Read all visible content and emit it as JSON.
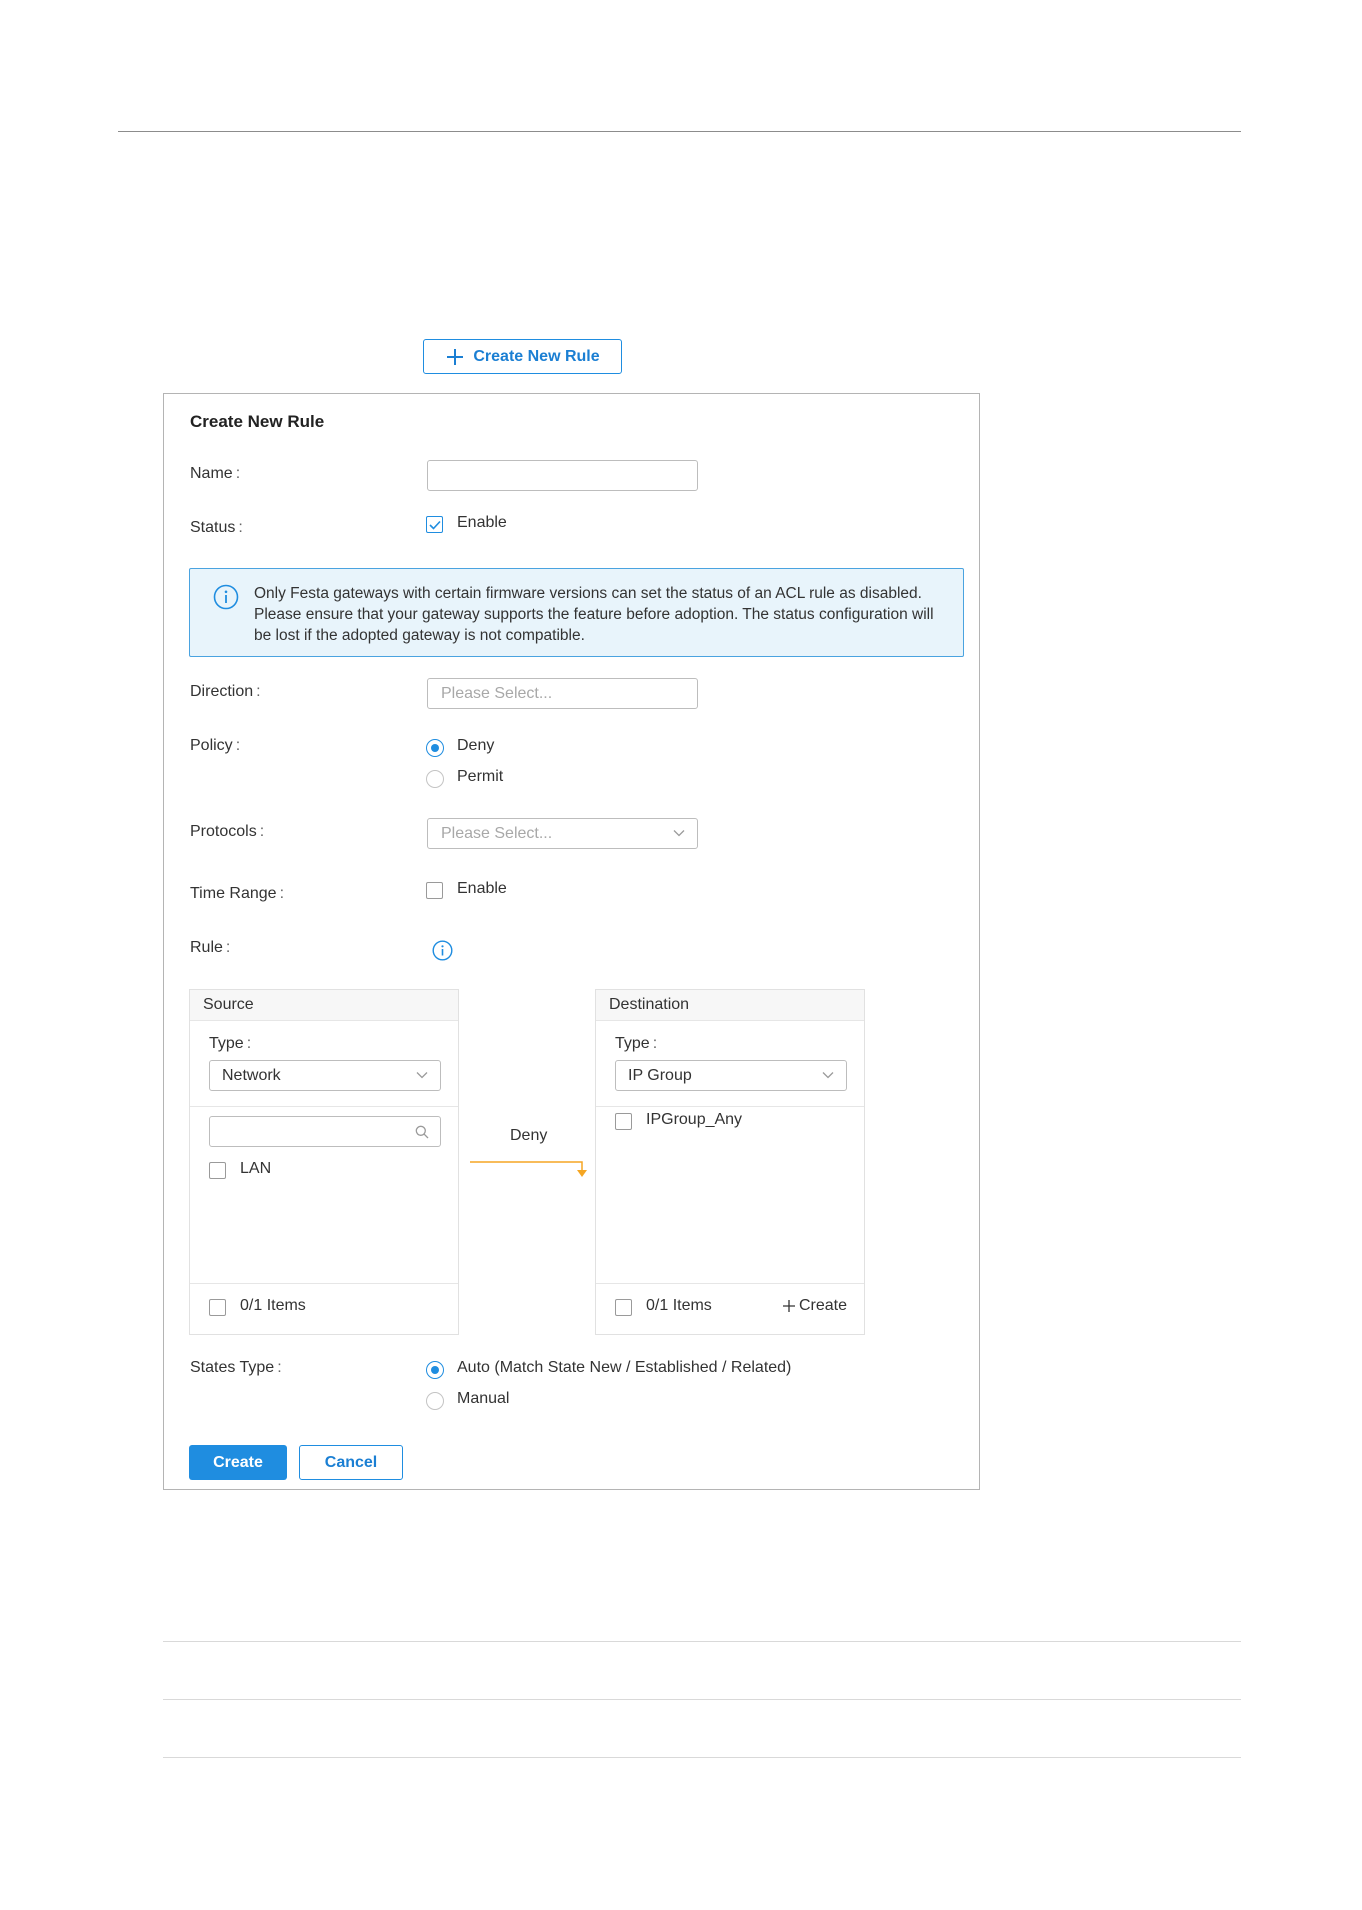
{
  "toolbar": {
    "create_new_rule_label": "Create New Rule"
  },
  "form": {
    "title": "Create New Rule",
    "name": {
      "label": "Name",
      "value": "",
      "placeholder": ""
    },
    "status": {
      "label": "Status",
      "option": "Enable",
      "checked": true
    },
    "notice": "Only Festa gateways with certain firmware versions can set the status of an ACL rule as disabled. Please ensure that your gateway supports the feature before adoption. The status configuration will be lost if the adopted gateway is not compatible.",
    "direction": {
      "label": "Direction",
      "placeholder": "Please Select..."
    },
    "policy": {
      "label": "Policy",
      "options": [
        "Deny",
        "Permit"
      ],
      "selected": "Deny"
    },
    "protocols": {
      "label": "Protocols",
      "placeholder": "Please Select..."
    },
    "time_range": {
      "label": "Time Range",
      "option": "Enable",
      "checked": false
    },
    "rule": {
      "label": "Rule"
    },
    "source": {
      "header": "Source",
      "type_label": "Type",
      "type_value": "Network",
      "search_value": "",
      "items": [
        "LAN"
      ],
      "count": "0/1 Items"
    },
    "flow_label": "Deny",
    "destination": {
      "header": "Destination",
      "type_label": "Type",
      "type_value": "IP Group",
      "items": [
        "IPGroup_Any"
      ],
      "count": "0/1 Items",
      "create_label": "Create"
    },
    "states_type": {
      "label": "States Type",
      "options": [
        "Auto (Match State New / Established / Related)",
        "Manual"
      ],
      "selected": "Auto (Match State New / Established / Related)"
    },
    "buttons": {
      "create": "Create",
      "cancel": "Cancel"
    }
  },
  "colors": {
    "accent": "#1f8de0",
    "notice_bg": "#e8f4fb",
    "arrow": "#f5a623"
  }
}
